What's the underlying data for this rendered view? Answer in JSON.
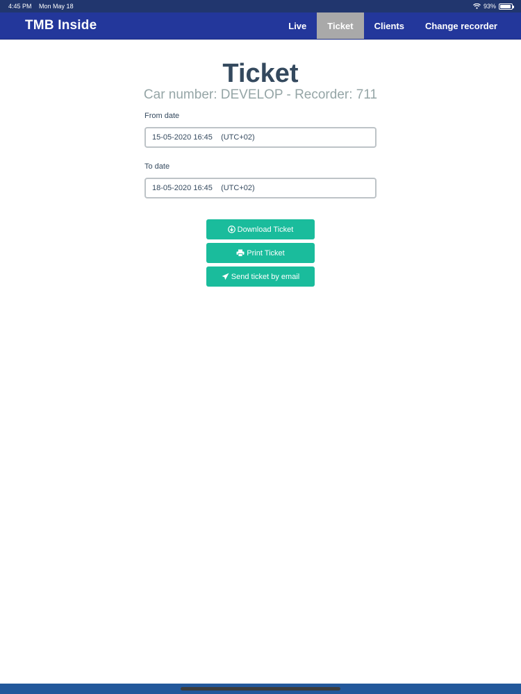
{
  "status_bar": {
    "time": "4:45 PM",
    "date": "Mon May 18",
    "battery": "93%",
    "battery_level": 0.93
  },
  "navbar": {
    "brand": "TMB Inside",
    "items": [
      {
        "label": "Live",
        "active": false
      },
      {
        "label": "Ticket",
        "active": true
      },
      {
        "label": "Clients",
        "active": false
      },
      {
        "label": "Change recorder",
        "active": false
      }
    ]
  },
  "page": {
    "title": "Ticket",
    "subtitle": "Car number: DEVELOP - Recorder: 711"
  },
  "form": {
    "from_label": "From date",
    "from_value": "15-05-2020 16:45    (UTC+02)",
    "to_label": "To date",
    "to_value": "18-05-2020 16:45    (UTC+02)"
  },
  "actions": {
    "download": {
      "label": "Download Ticket",
      "icon": "download-circle-icon"
    },
    "print": {
      "label": "Print Ticket",
      "icon": "printer-icon"
    },
    "email": {
      "label": "Send ticket by email",
      "icon": "paper-plane-icon"
    }
  },
  "colors": {
    "navbar": "#23379b",
    "nav_active": "#a9a9a9",
    "button": "#1abc9c",
    "title": "#34495e",
    "subtitle": "#95a5a6",
    "status_bar": "#21366e",
    "bottom_bar": "#23589b"
  }
}
